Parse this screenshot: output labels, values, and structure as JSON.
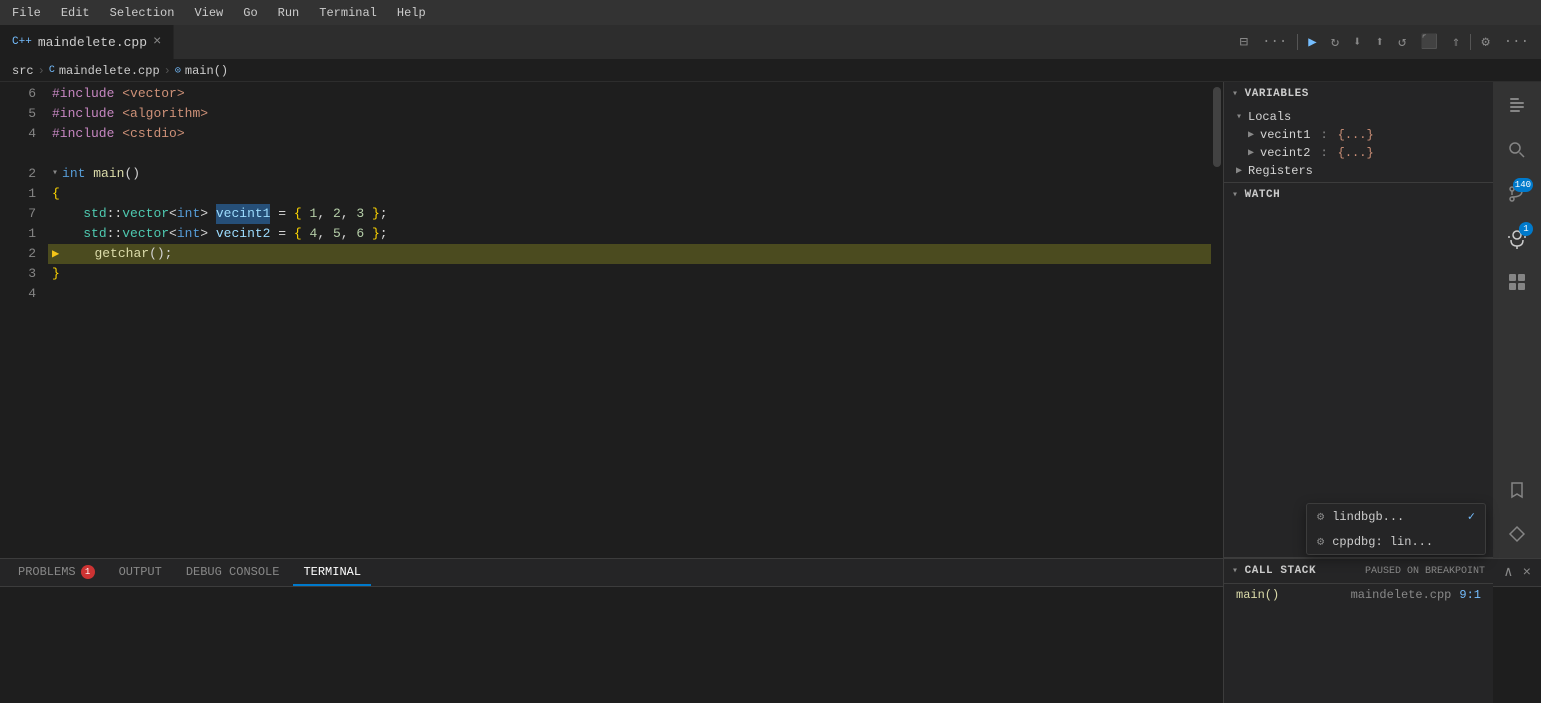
{
  "menubar": {
    "items": [
      "File",
      "Edit",
      "Selection",
      "View",
      "Go",
      "Run",
      "Terminal",
      "Help"
    ]
  },
  "tabs": {
    "open": [
      {
        "id": "maindelete-cpp",
        "label": "maindelete.cpp",
        "icon": "C++",
        "active": true,
        "closable": true
      }
    ]
  },
  "toolbar": {
    "buttons": [
      "⊟",
      "···",
      "⋮",
      "▷",
      "↻",
      "⬇",
      "⬆",
      "↺",
      "⬛",
      "⇑",
      "⚙",
      "···"
    ]
  },
  "breadcrumb": {
    "src": "src",
    "file": "maindelete.cpp",
    "symbol": "main()"
  },
  "editor": {
    "cursor_position": "Line 2",
    "lines": [
      {
        "num": "6",
        "indent": 0,
        "content": "#include <vector>",
        "type": "include"
      },
      {
        "num": "5",
        "indent": 0,
        "content": "#include <algorithm>",
        "type": "include"
      },
      {
        "num": "4",
        "indent": 0,
        "content": "#include <cstdio>",
        "type": "include"
      },
      {
        "num": "",
        "indent": 0,
        "content": "",
        "type": "blank"
      },
      {
        "num": "2",
        "indent": 0,
        "content": "int main()",
        "type": "function",
        "collapsed": false
      },
      {
        "num": "1",
        "indent": 0,
        "content": "{",
        "type": "bracket"
      },
      {
        "num": "7",
        "indent": 2,
        "content": "std::vector<int> vecint1 = { 1, 2, 3 };",
        "type": "code"
      },
      {
        "num": "1",
        "indent": 2,
        "content": "std::vector<int> vecint2 = { 4, 5, 6 };",
        "type": "code"
      },
      {
        "num": "2",
        "indent": 2,
        "content": "getchar();",
        "type": "code",
        "current": true
      },
      {
        "num": "3",
        "indent": 0,
        "content": "}",
        "type": "bracket"
      },
      {
        "num": "4",
        "indent": 0,
        "content": "",
        "type": "blank"
      }
    ]
  },
  "variables_panel": {
    "title": "VARIABLES",
    "sections": [
      {
        "label": "Locals",
        "items": [
          {
            "name": "vecint1",
            "value": "{...}"
          },
          {
            "name": "vecint2",
            "value": "{...}"
          }
        ]
      },
      {
        "label": "Registers",
        "items": []
      }
    ]
  },
  "watch_panel": {
    "title": "WATCH"
  },
  "call_stack_panel": {
    "title": "CALL STACK",
    "status": "PAUSED ON BREAKPOINT",
    "items": [
      {
        "name": "main()",
        "file": "maindelete.cpp",
        "line": "9:1"
      }
    ]
  },
  "bottom_tabs": {
    "tabs": [
      {
        "id": "problems",
        "label": "PROBLEMS",
        "badge": "1",
        "active": false
      },
      {
        "id": "output",
        "label": "OUTPUT",
        "badge": null,
        "active": false
      },
      {
        "id": "debug-console",
        "label": "DEBUG CONSOLE",
        "badge": null,
        "active": false
      },
      {
        "id": "terminal",
        "label": "TERMINAL",
        "badge": null,
        "active": true
      }
    ],
    "add_btn": "+",
    "up_btn": "∧",
    "close_btn": "×"
  },
  "terminal_dropdown": {
    "items": [
      {
        "icon": "⚙",
        "label": "lindbgb...",
        "checked": true
      },
      {
        "icon": "⚙",
        "label": "cppdbg: lin...",
        "checked": false
      }
    ]
  },
  "activity_bar": {
    "icons": [
      {
        "id": "explorer",
        "glyph": "⎘",
        "badge": null
      },
      {
        "id": "search",
        "glyph": "🔍",
        "badge": null
      },
      {
        "id": "source-control",
        "glyph": "⎇",
        "badge": "140"
      },
      {
        "id": "debug",
        "glyph": "▶",
        "badge": "1"
      },
      {
        "id": "extensions",
        "glyph": "⊞",
        "badge": null
      },
      {
        "id": "bookmarks",
        "glyph": "🔖",
        "badge": null
      },
      {
        "id": "remote",
        "glyph": "◇",
        "badge": null
      }
    ]
  }
}
